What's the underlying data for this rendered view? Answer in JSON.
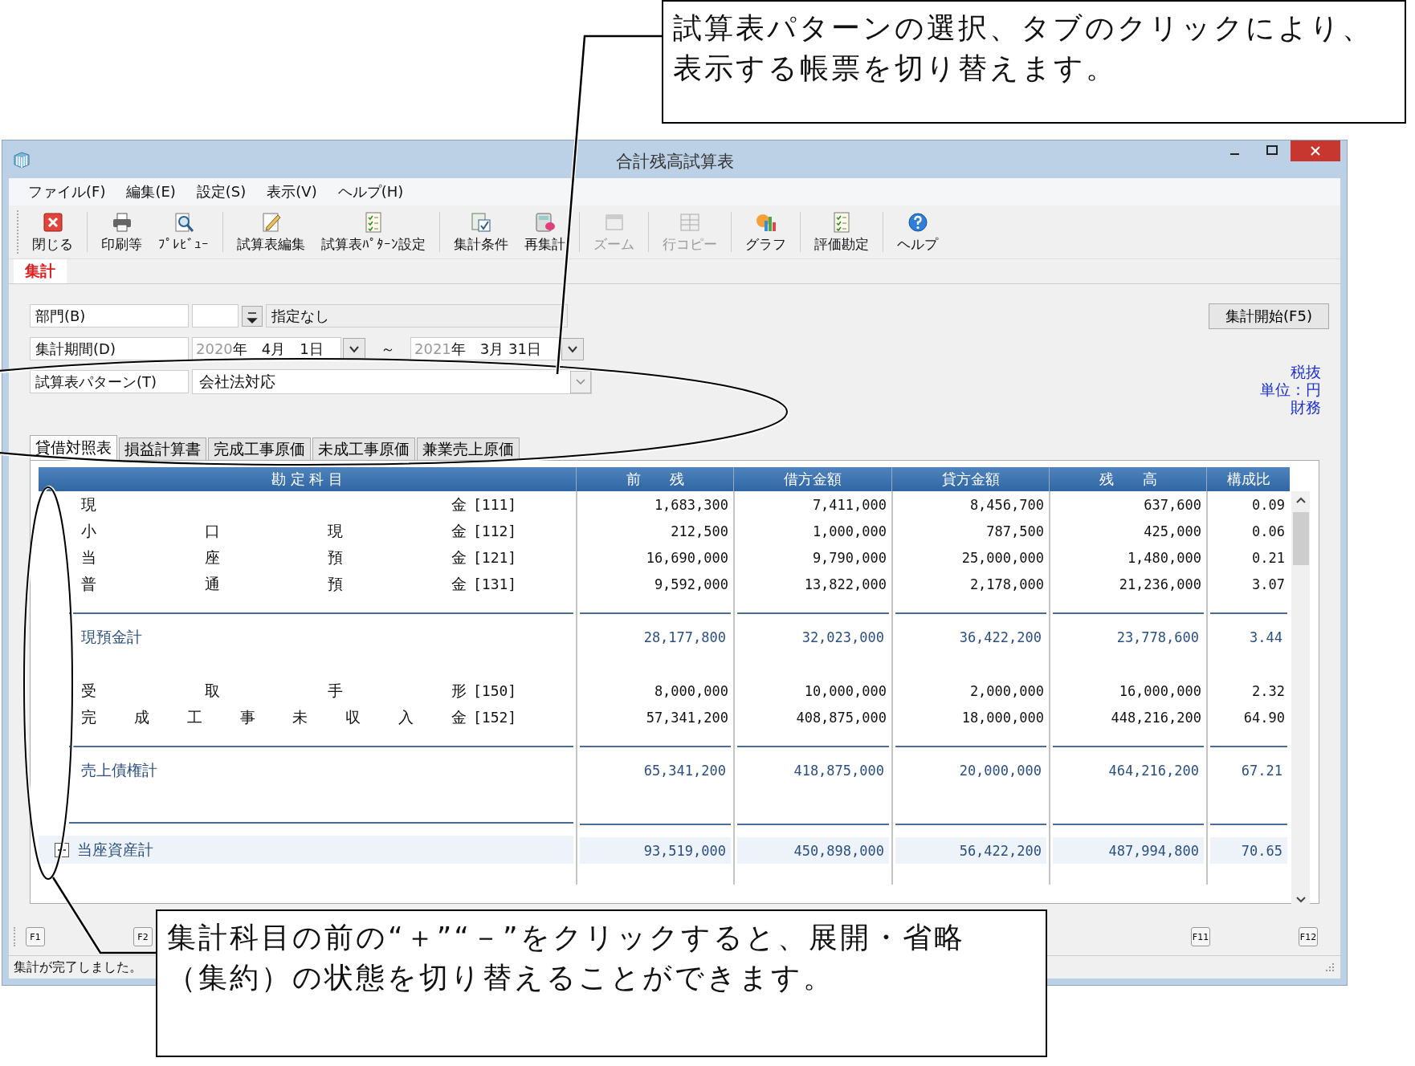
{
  "callout_top": {
    "text": "試算表パターンの選択、タブのクリックにより、表示する帳票を切り替えます。"
  },
  "callout_bottom": {
    "text": "集計科目の前の“＋”“－”をクリックすると、展開・省略（集約）の状態を切り替えることができます。"
  },
  "window": {
    "title": "合計残高試算表"
  },
  "menu": [
    "ファイル(F)",
    "編集(E)",
    "設定(S)",
    "表示(V)",
    "ヘルプ(H)"
  ],
  "toolbar_groups": [
    [
      {
        "label": "閉じる",
        "disabled": false
      }
    ],
    [
      {
        "label": "印刷等",
        "disabled": false
      },
      {
        "label": "ﾌﾟﾚﾋﾞｭｰ",
        "disabled": false
      }
    ],
    [
      {
        "label": "試算表編集",
        "disabled": false
      },
      {
        "label": "試算表ﾊﾟﾀｰﾝ設定",
        "disabled": false
      }
    ],
    [
      {
        "label": "集計条件",
        "disabled": false
      },
      {
        "label": "再集計",
        "disabled": false
      }
    ],
    [
      {
        "label": "ズーム",
        "disabled": true
      }
    ],
    [
      {
        "label": "行コピー",
        "disabled": true
      }
    ],
    [
      {
        "label": "グラフ",
        "disabled": false
      }
    ],
    [
      {
        "label": "評価勘定",
        "disabled": false
      }
    ],
    [
      {
        "label": "ヘルプ",
        "disabled": false
      }
    ]
  ],
  "mode_tabs": [
    {
      "label": "集計",
      "selected": true
    }
  ],
  "form": {
    "department": {
      "label": "部門(B)",
      "name": "指定なし"
    },
    "period": {
      "label": "集計期間(D)",
      "from": {
        "year": "2020",
        "rest": "年　4月　1日"
      },
      "separator": "～",
      "to": {
        "year": "2021",
        "rest": "年　3月 31日"
      }
    },
    "pattern": {
      "label": "試算表パターン(T)",
      "value": "会社法対応"
    }
  },
  "start_button": "集計開始(F5)",
  "info": [
    "税抜",
    "単位：円",
    "財務"
  ],
  "report_tabs": [
    {
      "label": "貸借対照表",
      "selected": true
    },
    {
      "label": "損益計算書",
      "selected": false
    },
    {
      "label": "完成工事原価",
      "selected": false
    },
    {
      "label": "未成工事原価",
      "selected": false
    },
    {
      "label": "兼業売上原価",
      "selected": false
    }
  ],
  "table": {
    "columns": [
      "勘 定 科 目",
      "前　　残",
      "借方金額",
      "貸方金額",
      "残　　高",
      "構成比"
    ],
    "rows": [
      {
        "kind": "account",
        "name": "現金",
        "code": "[111]",
        "values": [
          "1,683,300",
          "7,411,000",
          "8,456,700",
          "637,600",
          "0.09"
        ]
      },
      {
        "kind": "account",
        "name": "小口現金",
        "code": "[112]",
        "values": [
          "212,500",
          "1,000,000",
          "787,500",
          "425,000",
          "0.06"
        ]
      },
      {
        "kind": "account",
        "name": "当座預金",
        "code": "[121]",
        "values": [
          "16,690,000",
          "9,790,000",
          "25,000,000",
          "1,480,000",
          "0.21"
        ]
      },
      {
        "kind": "account",
        "name": "普通預金",
        "code": "[131]",
        "values": [
          "9,592,000",
          "13,822,000",
          "2,178,000",
          "21,236,000",
          "3.07"
        ]
      },
      {
        "kind": "subtotal",
        "name": "現預金計",
        "values": [
          "28,177,800",
          "32,023,000",
          "36,422,200",
          "23,778,600",
          "3.44"
        ]
      },
      {
        "kind": "account",
        "name": "受取手形",
        "code": "[150]",
        "values": [
          "8,000,000",
          "10,000,000",
          "2,000,000",
          "16,000,000",
          "2.32"
        ]
      },
      {
        "kind": "account",
        "name": "完成工事未収入金",
        "code": "[152]",
        "values": [
          "57,341,200",
          "408,875,000",
          "18,000,000",
          "448,216,200",
          "64.90"
        ]
      },
      {
        "kind": "subtotal",
        "name": "売上債権計",
        "values": [
          "65,341,200",
          "418,875,000",
          "20,000,000",
          "464,216,200",
          "67.21"
        ]
      },
      {
        "kind": "total",
        "name": "当座資産計",
        "expanded": true,
        "values": [
          "93,519,000",
          "450,898,000",
          "56,422,200",
          "487,994,800",
          "70.65"
        ]
      }
    ]
  },
  "function_keys_left": [
    "F1",
    "F2"
  ],
  "function_keys_right": [
    "F11",
    "F12"
  ],
  "status_bar": "集計が完了しました。"
}
